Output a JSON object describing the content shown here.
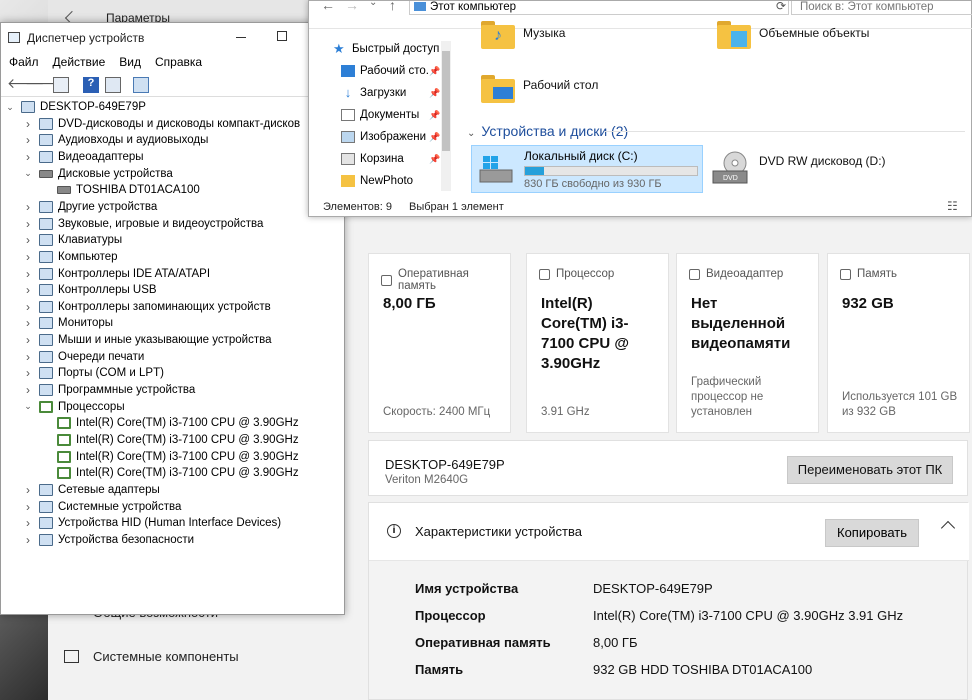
{
  "settings": {
    "title": "Параметры",
    "cards": [
      {
        "header": "Оперативная память",
        "value": "8,00 ГБ",
        "footer": "Скорость: 2400 МГц"
      },
      {
        "header": "Процессор",
        "value": "Intel(R) Core(TM) i3-7100 CPU @ 3.90GHz",
        "footer": "3.91 GHz"
      },
      {
        "header": "Видеоадаптер",
        "value": "Нет выделенной видеопамяти",
        "footer": "Графический процессор не установлен"
      },
      {
        "header": "Память",
        "value": "932 GB",
        "footer": "Используется 101 GB из 932 GB"
      }
    ],
    "pc_name": "DESKTOP-649E79P",
    "pc_model": "Veriton M2640G",
    "rename_button": "Переименовать этот ПК",
    "specs_title": "Характеристики устройства",
    "copy_button": "Копировать",
    "specs": [
      {
        "key": "Имя устройства",
        "value": "DESKTOP-649E79P"
      },
      {
        "key": "Процессор",
        "value": "Intel(R) Core(TM) i3-7100 CPU @ 3.90GHz   3.91 GHz"
      },
      {
        "key": "Оперативная память",
        "value": "8,00 ГБ"
      },
      {
        "key": "Память",
        "value": "932 GB HDD TOSHIBA DT01ACA100"
      }
    ],
    "left_nav": [
      {
        "label": "Общие возможности"
      },
      {
        "label": "Системные компоненты"
      }
    ]
  },
  "devmgr": {
    "title": "Диспетчер устройств",
    "menu": [
      "Файл",
      "Действие",
      "Вид",
      "Справка"
    ],
    "tree": [
      {
        "label": "DESKTOP-649E79P",
        "level": 0,
        "expand": "down",
        "icon": "computer-icon"
      },
      {
        "label": "DVD-дисководы и дисководы компакт-дисков",
        "level": 1,
        "expand": "right",
        "icon": "dvd-drive-icon"
      },
      {
        "label": "Аудиовходы и аудиовыходы",
        "level": 1,
        "expand": "right",
        "icon": "audio-icon"
      },
      {
        "label": "Видеоадаптеры",
        "level": 1,
        "expand": "right",
        "icon": "display-adapter-icon"
      },
      {
        "label": "Дисковые устройства",
        "level": 1,
        "expand": "down",
        "icon": "disk-icon"
      },
      {
        "label": "TOSHIBA DT01ACA100",
        "level": 2,
        "expand": "",
        "icon": "disk-icon"
      },
      {
        "label": "Другие устройства",
        "level": 1,
        "expand": "right",
        "icon": "unknown-device-icon"
      },
      {
        "label": "Звуковые, игровые и видеоустройства",
        "level": 1,
        "expand": "right",
        "icon": "speaker-icon"
      },
      {
        "label": "Клавиатуры",
        "level": 1,
        "expand": "right",
        "icon": "keyboard-icon"
      },
      {
        "label": "Компьютер",
        "level": 1,
        "expand": "right",
        "icon": "computer-icon"
      },
      {
        "label": "Контроллеры IDE ATA/ATAPI",
        "level": 1,
        "expand": "right",
        "icon": "ide-controller-icon"
      },
      {
        "label": "Контроллеры USB",
        "level": 1,
        "expand": "right",
        "icon": "usb-icon"
      },
      {
        "label": "Контроллеры запоминающих устройств",
        "level": 1,
        "expand": "right",
        "icon": "storage-controller-icon"
      },
      {
        "label": "Мониторы",
        "level": 1,
        "expand": "right",
        "icon": "monitor-icon"
      },
      {
        "label": "Мыши и иные указывающие устройства",
        "level": 1,
        "expand": "right",
        "icon": "mouse-icon"
      },
      {
        "label": "Очереди печати",
        "level": 1,
        "expand": "right",
        "icon": "printer-icon"
      },
      {
        "label": "Порты (COM и LPT)",
        "level": 1,
        "expand": "right",
        "icon": "port-icon"
      },
      {
        "label": "Программные устройства",
        "level": 1,
        "expand": "right",
        "icon": "software-device-icon"
      },
      {
        "label": "Процессоры",
        "level": 1,
        "expand": "down",
        "icon": "cpu-icon"
      },
      {
        "label": "Intel(R) Core(TM) i3-7100 CPU @ 3.90GHz",
        "level": 2,
        "expand": "",
        "icon": "cpu-icon"
      },
      {
        "label": "Intel(R) Core(TM) i3-7100 CPU @ 3.90GHz",
        "level": 2,
        "expand": "",
        "icon": "cpu-icon"
      },
      {
        "label": "Intel(R) Core(TM) i3-7100 CPU @ 3.90GHz",
        "level": 2,
        "expand": "",
        "icon": "cpu-icon"
      },
      {
        "label": "Intel(R) Core(TM) i3-7100 CPU @ 3.90GHz",
        "level": 2,
        "expand": "",
        "icon": "cpu-icon"
      },
      {
        "label": "Сетевые адаптеры",
        "level": 1,
        "expand": "right",
        "icon": "network-adapter-icon"
      },
      {
        "label": "Системные устройства",
        "level": 1,
        "expand": "right",
        "icon": "system-device-icon"
      },
      {
        "label": "Устройства HID (Human Interface Devices)",
        "level": 1,
        "expand": "right",
        "icon": "hid-icon"
      },
      {
        "label": "Устройства безопасности",
        "level": 1,
        "expand": "right",
        "icon": "security-device-icon"
      }
    ]
  },
  "explorer": {
    "path": "Этот компьютер",
    "search_placeholder": "Поиск в: Этот компьютер",
    "nav": [
      {
        "label": "Быстрый доступ",
        "pinned": false
      },
      {
        "label": "Рабочий сто.",
        "pinned": true
      },
      {
        "label": "Загрузки",
        "pinned": true
      },
      {
        "label": "Документы",
        "pinned": true
      },
      {
        "label": "Изображени",
        "pinned": true
      },
      {
        "label": "Корзина",
        "pinned": true
      },
      {
        "label": "NewPhoto",
        "pinned": false
      }
    ],
    "folders": [
      {
        "label": "Музыка"
      },
      {
        "label": "Объемные объекты"
      },
      {
        "label": "Рабочий стол"
      }
    ],
    "group_title": "Устройства и диски (2)",
    "drive_c": {
      "label": "Локальный диск (C:)",
      "free": "830 ГБ свободно из 930 ГБ",
      "used_fraction": 0.11
    },
    "drive_d": {
      "label": "DVD RW дисковод (D:)"
    },
    "status_items": "Элементов: 9",
    "status_selected": "Выбран 1 элемент"
  }
}
